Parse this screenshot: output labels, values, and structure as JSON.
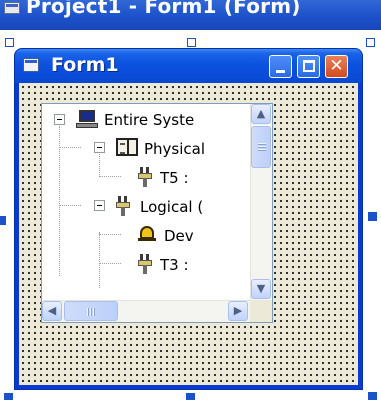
{
  "designer": {
    "title": "Project1 - Form1 (Form)"
  },
  "form": {
    "title": "Form1",
    "buttons": {
      "minimize": "minimize",
      "maximize": "maximize",
      "close": "✕"
    }
  },
  "tree": {
    "nodes": [
      {
        "label": "Entire Syste",
        "icon": "computer-icon",
        "level": 0,
        "expanded": true
      },
      {
        "label": "Physical",
        "icon": "book-icon",
        "level": 1,
        "expanded": true
      },
      {
        "label": "T5 :",
        "icon": "plug-icon",
        "level": 2
      },
      {
        "label": "Logical (",
        "icon": "plug-icon",
        "level": 1,
        "expanded": true
      },
      {
        "label": "Dev",
        "icon": "bell-icon",
        "level": 2
      },
      {
        "label": "T3 :",
        "icon": "plug-icon",
        "level": 2
      }
    ]
  },
  "scrollbars": {
    "up": "▲",
    "down": "▼",
    "left": "◀",
    "right": "▶"
  },
  "colors": {
    "form_titlebar": "#0a4cd8",
    "form_background": "#ece9d8",
    "handle": "#1a52c9"
  }
}
